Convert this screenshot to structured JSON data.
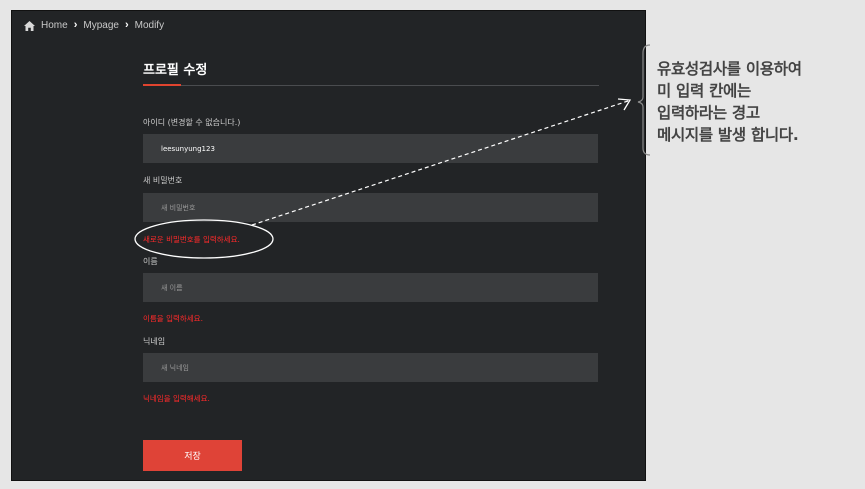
{
  "breadcrumb": {
    "items": [
      "Home",
      "Mypage",
      "Modify"
    ]
  },
  "page": {
    "title": "프로필 수정"
  },
  "form": {
    "id_label": "아이디 (변경할 수 없습니다.)",
    "id_value": "leesunyung123",
    "password_label": "새 비밀번호",
    "password_placeholder": "새 비밀번호",
    "password_error": "새로운 비밀번호를 입력하세요.",
    "name_label": "이름",
    "name_placeholder": "새 이름",
    "name_error": "이름을 입력하세요.",
    "nickname_label": "닉네임",
    "nickname_placeholder": "새 닉네임",
    "nickname_error": "닉네임을 입력해세요.",
    "save_label": "저장"
  },
  "annotation": {
    "lines": [
      "유효성검사를 이용하여",
      "미 입력 칸에는",
      "입력하라는 경고",
      "메시지를 발생 합니다."
    ]
  },
  "colors": {
    "background": "#222426",
    "input_bg": "#3a3c3e",
    "accent": "#df4337",
    "error": "#ff2a2a"
  },
  "icons": {
    "home": "home-icon",
    "chevron": "chevron-right-icon"
  }
}
